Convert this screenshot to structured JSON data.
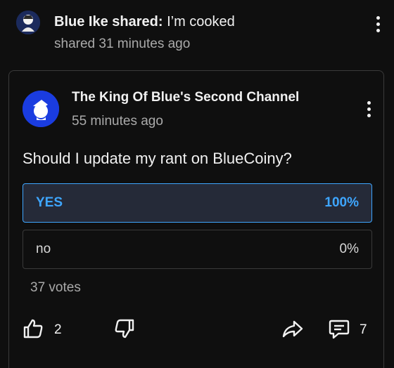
{
  "share": {
    "author": "Blue Ike shared:",
    "text": "I’m cooked",
    "time": "shared 31 minutes ago"
  },
  "post": {
    "channel_name": "The King Of Blue's Second Channel",
    "time": "55 minutes ago",
    "question": "Should I update my rant on BlueCoiny?",
    "options": [
      {
        "label": "YES",
        "percent": "100%"
      },
      {
        "label": "no",
        "percent": "0%"
      }
    ],
    "votes": "37 votes"
  },
  "actions": {
    "likes": "2",
    "comments": "7"
  },
  "icons": {
    "like": "thumbs-up-icon",
    "dislike": "thumbs-down-icon",
    "share": "share-arrow-icon",
    "comment": "comment-icon",
    "menu": "kebab-menu-icon"
  },
  "colors": {
    "background": "#0f0f0f",
    "accent": "#3ea6ff",
    "selected_option_bg": "#252a38",
    "channel_avatar_bg": "#1a3ce0"
  }
}
